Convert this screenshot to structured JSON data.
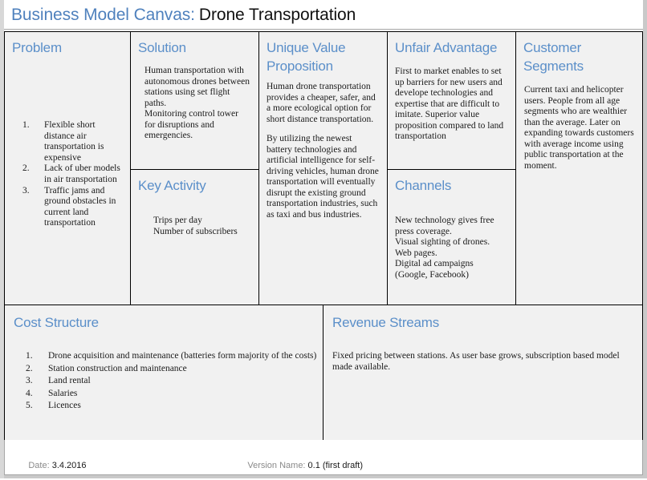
{
  "title": {
    "label": "Business Model Canvas:",
    "value": "Drone Transportation"
  },
  "colors": {
    "heading_blue": "#5b8fc9",
    "title_blue": "#4f81bd",
    "cell_background": "#f1f1f1",
    "border": "#000000",
    "footer_label": "#8a8a8a"
  },
  "blocks": {
    "problem": {
      "heading": "Problem",
      "items": [
        "Flexible short distance air transportation is expensive",
        "Lack of uber models in air transportation",
        "Traffic jams and ground obstacles in current land transportation"
      ]
    },
    "solution": {
      "heading": "Solution",
      "lines": [
        "Human transportation with autonomous drones between stations using set flight paths.",
        "Monitoring control tower for disruptions and emergencies."
      ]
    },
    "key_activity": {
      "heading": "Key Activity",
      "lines": [
        "Trips per day",
        "Number of subscribers"
      ]
    },
    "unique_value_proposition": {
      "heading": "Unique Value Proposition",
      "paragraphs": [
        "Human drone transportation provides  a cheaper, safer, and a more ecological option for short distance transportation.",
        "By utilizing the newest battery technologies and artificial intelligence for self-driving vehicles, human drone transportation will eventually disrupt the existing ground transportation industries, such as taxi and bus industries."
      ]
    },
    "unfair_advantage": {
      "heading": "Unfair Advantage",
      "paragraphs": [
        "First to market enables to set up barriers for new users and develope technologies and expertise that are difficult to imitate. Superior value proposition compared to land transportation"
      ]
    },
    "channels": {
      "heading": "Channels",
      "lines": [
        "New technology gives free press coverage.",
        "Visual sighting of drones.",
        "Web pages.",
        "Digital ad campaigns (Google, Facebook)"
      ]
    },
    "customer_segments": {
      "heading": "Customer Segments",
      "paragraphs": [
        "Current taxi and helicopter users. People from all age segments who are wealthier than the average. Later on expanding towards customers with average income using public transportation at the moment."
      ]
    },
    "cost_structure": {
      "heading": "Cost Structure",
      "items": [
        "Drone acquisition and maintenance (batteries form majority of the costs)",
        "Station construction and maintenance",
        "Land rental",
        "Salaries",
        "Licences"
      ]
    },
    "revenue_streams": {
      "heading": "Revenue Streams",
      "paragraphs": [
        "Fixed pricing between stations. As user base grows,  subscription based model made available."
      ]
    }
  },
  "footer": {
    "date_label": "Date: ",
    "date_value": "3.4.2016",
    "version_label": "Version Name: ",
    "version_value": "0.1 (first draft)"
  }
}
